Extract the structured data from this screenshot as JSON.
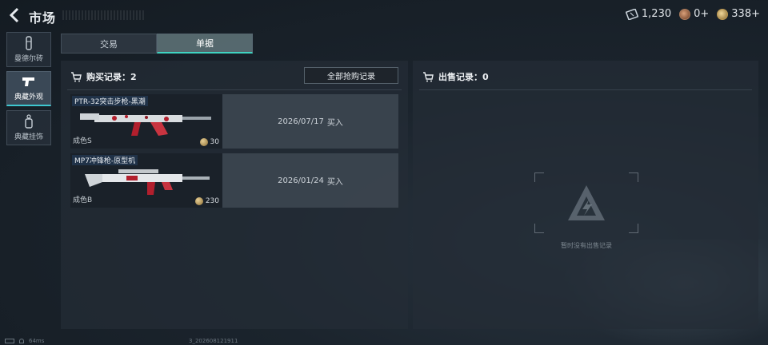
{
  "header": {
    "title": "市场",
    "currencies": [
      {
        "icon": "ticket-icon",
        "value": "1,230"
      },
      {
        "icon": "badge-coin-icon",
        "value": "0+"
      },
      {
        "icon": "gold-coin-icon",
        "value": "338+"
      }
    ]
  },
  "sidebar": {
    "items": [
      {
        "label": "曼德尔砖",
        "icon": "brick-icon",
        "active": false
      },
      {
        "label": "典藏外观",
        "icon": "pistol-icon",
        "active": true
      },
      {
        "label": "典藏挂饰",
        "icon": "charm-icon",
        "active": false
      }
    ]
  },
  "tabs": [
    {
      "label": "交易",
      "active": false
    },
    {
      "label": "单据",
      "active": true
    }
  ],
  "purchase": {
    "title": "购买记录：2",
    "all_button": "全部抢购记录",
    "records": [
      {
        "name": "PTR-32突击步枪-黑潮",
        "grade": "成色S",
        "price": "30",
        "date": "2026/07/17",
        "action": "买入"
      },
      {
        "name": "MP7冲锋枪-原型机",
        "grade": "成色B",
        "price": "230",
        "date": "2026/01/24",
        "action": "买入"
      }
    ]
  },
  "sale": {
    "title": "出售记录：0",
    "empty_text": "暂时没有出售记录"
  },
  "status": {
    "ping": "64ms",
    "build": "3_202608121911"
  },
  "colors": {
    "accent": "#3fd4c2",
    "panel": "#242d36",
    "background": "#161d24"
  }
}
